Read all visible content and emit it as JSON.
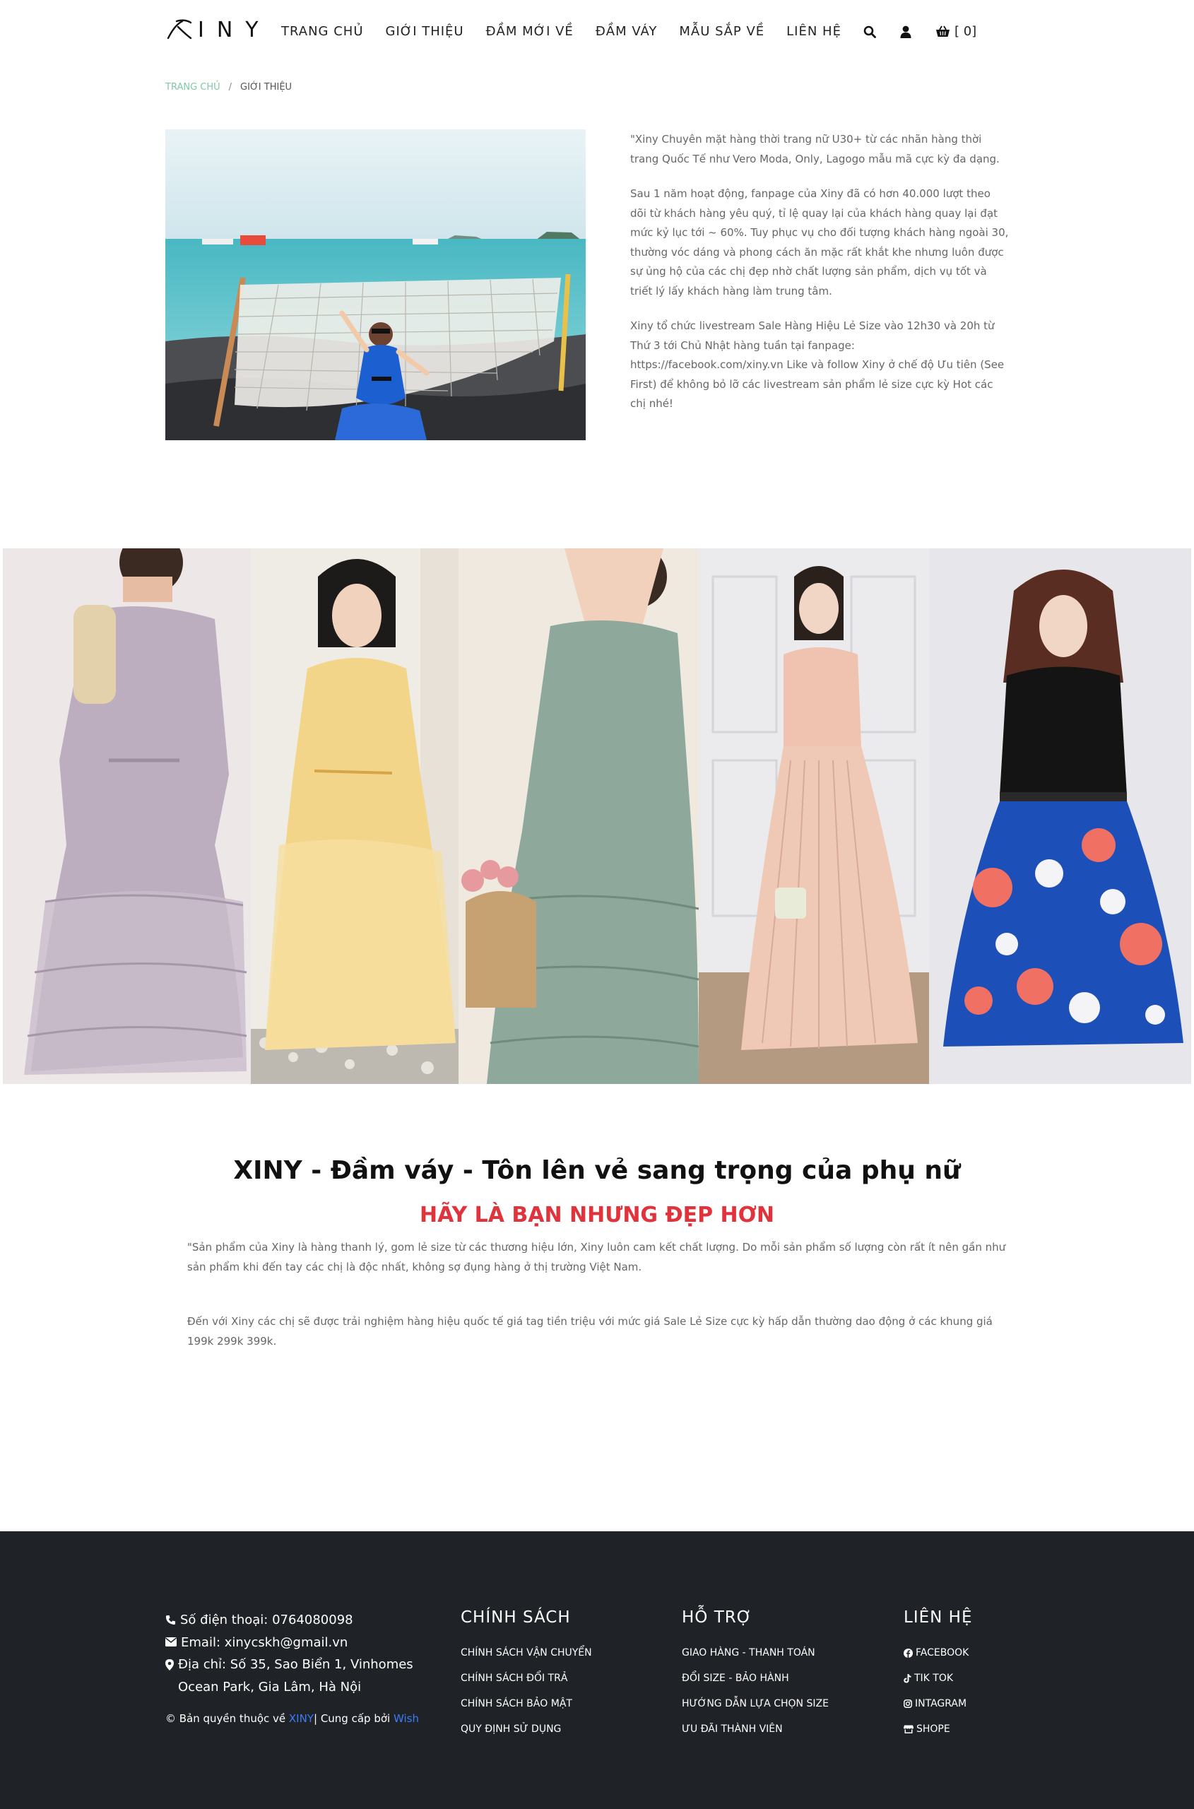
{
  "header": {
    "logo_text": "INY",
    "logo_full": "XINY",
    "nav": [
      "TRANG CHỦ",
      "GIỚI THIỆU",
      "ĐẦM MỚI VỀ",
      "ĐẦM VÁY",
      "MẪU SẮP VỀ",
      "LIÊN HỆ"
    ],
    "search_icon": "search-icon",
    "account_icon": "user-icon",
    "cart_icon": "basket-icon",
    "cart_label": "[ 0]"
  },
  "breadcrumb": {
    "home": "TRANG CHỦ",
    "separator": "/",
    "current": "GIỚI THIỆU"
  },
  "intro": {
    "paragraphs": [
      "\"Xiny Chuyên mặt hàng thời trang nữ U30+ từ các nhãn hàng thời trang Quốc Tế như Vero Moda, Only, Lagogo mẫu mã cực kỳ đa dạng.",
      "Sau 1 năm hoạt động, fanpage của Xiny đã có hơn 40.000 lượt theo dõi từ khách hàng yêu quý, tỉ lệ quay lại của khách hàng quay lại đạt mức kỷ lục tới ~ 60%. Tuy phục vụ cho đối tượng khách hàng ngoài 30, thường vóc dáng và phong cách ăn mặc rất khắt khe nhưng luôn được sự ủng hộ của các chị đẹp nhờ chất lượng sản phẩm, dịch vụ tốt và triết lý lấy khách hàng làm trung tâm.",
      "Xiny tổ chức livestream Sale Hàng Hiệu Lẻ Size vào 12h30 và 20h từ Thứ 3 tới Chủ Nhật hàng tuần tại fanpage: https://facebook.com/xiny.vn Like và follow Xiny ở chế độ Ưu tiên (See First) để không bỏ lỡ các livestream sản phẩm lẻ size cực kỳ Hot các chị nhé!"
    ]
  },
  "tagline": {
    "title": "XINY - Đầm váy - Tôn lên vẻ sang trọng của phụ nữ",
    "subtitle": "HÃY LÀ BẠN NHƯNG ĐẸP HƠN",
    "paragraph_1": "\"Sản phẩm của Xiny là hàng thanh lý, gom lẻ size từ các thương hiệu lớn, Xiny luôn cam kết chất lượng. Do mỗi sản phẩm số lượng còn rất ít nên gần như sản phẩm khi đến tay các chị là độc nhất, không sợ đụng hàng ở thị trường Việt Nam.",
    "paragraph_2": "Đến với Xiny các chị sẽ được trải nghiệm hàng hiệu quốc tế giá tag tiền triệu với mức giá Sale Lẻ Size cực kỳ hấp dẫn thường dao động ở các khung giá 199k 299k 399k."
  },
  "footer": {
    "phone": "Số điện thoại: 0764080098",
    "email": "Email: xinycskh@gmail.vn",
    "address": "Địa chỉ: Số 35, Sao Biển 1, Vinhomes Ocean Park, Gia Lâm, Hà Nội",
    "copyright_prefix": "© Bản quyền thuộc về ",
    "copyright_brand": "XINY",
    "copyright_mid": "| Cung cấp bởi ",
    "copyright_provider": "Wish",
    "columns": [
      {
        "title": "CHÍNH SÁCH",
        "links": [
          "CHÍNH SÁCH VẬN CHUYỂN",
          "CHÍNH SÁCH ĐỔI TRẢ",
          "CHÍNH SÁCH BẢO MẬT",
          "QUY ĐỊNH SỬ DỤNG"
        ]
      },
      {
        "title": "HỖ TRỢ",
        "links": [
          "GIAO HÀNG - THANH TOÁN",
          "ĐỔI SIZE - BẢO HÀNH",
          "HƯỚNG DẪN LỰA CHỌN SIZE",
          "ƯU ĐÃI THÀNH VIÊN"
        ]
      },
      {
        "title": "LIÊN HỆ",
        "links": [
          "FACEBOOK",
          "TIK TOK",
          "INTAGRAM",
          "SHOPE"
        ],
        "icons": [
          "facebook-icon",
          "tiktok-icon",
          "instagram-icon",
          "shop-icon"
        ]
      }
    ]
  },
  "colors": {
    "accent_red": "#e0333c",
    "breadcrumb_green": "#7fc9a4",
    "footer_bg": "#1f2226",
    "link_blue": "#3b7cf7"
  }
}
